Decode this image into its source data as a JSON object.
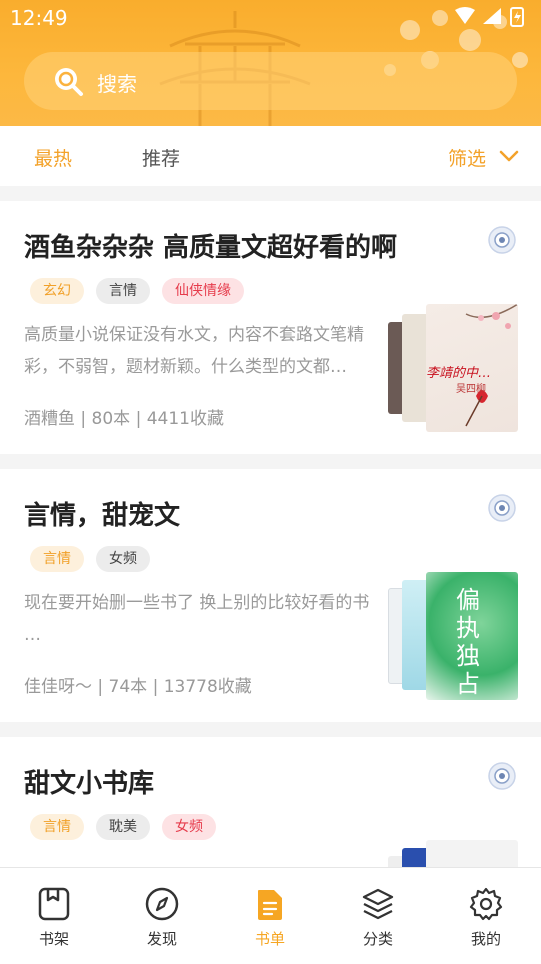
{
  "status_bar": {
    "time": "12:49"
  },
  "search": {
    "placeholder": "搜索"
  },
  "tabs": {
    "hot": "最热",
    "recommend": "推荐",
    "filter": "筛选"
  },
  "colors": {
    "accent": "#f6a623",
    "tag_orange": "#f1a028",
    "tag_red": "#e63b4b"
  },
  "booklists": [
    {
      "title": "酒鱼杂杂杂 高质量文超好看的啊",
      "tags": [
        {
          "label": "玄幻",
          "style": "orange"
        },
        {
          "label": "言情",
          "style": "gray"
        },
        {
          "label": "仙侠情缘",
          "style": "red"
        }
      ],
      "description": "高质量小说保证没有水文，内容不套路文笔精彩，不弱智，题材新颖。什么类型的文都…",
      "meta": "酒糟鱼 | 80本 | 4411收藏",
      "cover_title": "不。李靖的中…",
      "cover_author": "吴四柳"
    },
    {
      "title": "言情，甜宠文",
      "tags": [
        {
          "label": "言情",
          "style": "orange"
        },
        {
          "label": "女频",
          "style": "gray"
        }
      ],
      "description": "现在要开始删一些书了 换上别的比较好看的书 …",
      "meta": "佳佳呀～ | 74本 | 13778收藏",
      "cover_title": "偏执独占"
    },
    {
      "title": "甜文小书库",
      "tags": [
        {
          "label": "言情",
          "style": "orange"
        },
        {
          "label": "耽美",
          "style": "gray"
        },
        {
          "label": "女频",
          "style": "red"
        }
      ]
    }
  ],
  "nav": {
    "shelf": "书架",
    "discover": "发现",
    "booklist": "书单",
    "category": "分类",
    "mine": "我的"
  }
}
